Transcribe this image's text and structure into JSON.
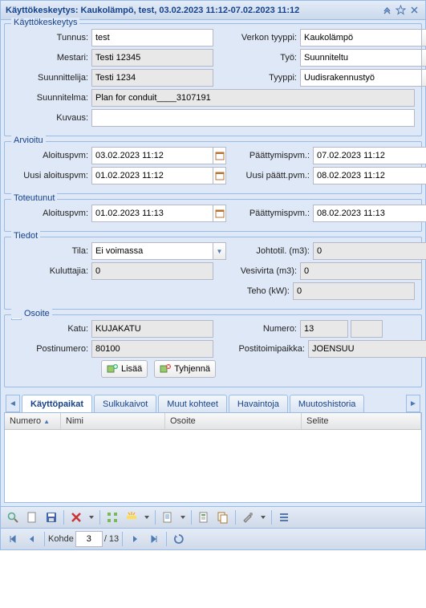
{
  "header": {
    "title": "Käyttökeskeytys: Kaukolämpö, test, 03.02.2023 11:12-07.02.2023 11:12"
  },
  "fs1": {
    "legend": "Käyttökeskeytys",
    "tunnus_label": "Tunnus:",
    "tunnus": "test",
    "verkko_label": "Verkon tyyppi:",
    "verkko": "Kaukolämpö",
    "mestari_label": "Mestari:",
    "mestari": "Testi 12345",
    "tyo_label": "Työ:",
    "tyo": "Suunniteltu",
    "suunnittelija_label": "Suunnittelija:",
    "suunnittelija": "Testi 1234",
    "tyyppi_label": "Tyyppi:",
    "tyyppi": "Uudisrakennustyö",
    "suunnitelma_label": "Suunnitelma:",
    "suunnitelma": "Plan for conduit____3107191",
    "kuvaus_label": "Kuvaus:",
    "kuvaus": ""
  },
  "fs2": {
    "legend": "Arvioitu",
    "aloitus_label": "Aloituspvm:",
    "aloitus": "03.02.2023 11:12",
    "paatty_label": "Päättymispvm.:",
    "paatty": "07.02.2023 11:12",
    "uusi_aloitus_label": "Uusi aloituspvm:",
    "uusi_aloitus": "01.02.2023 11:12",
    "uusi_paatty_label": "Uusi päätt.pvm.:",
    "uusi_paatty": "08.02.2023 11:12"
  },
  "fs3": {
    "legend": "Toteutunut",
    "aloitus_label": "Aloituspvm:",
    "aloitus": "01.02.2023 11:13",
    "paatty_label": "Päättymispvm.:",
    "paatty": "08.02.2023 11:13"
  },
  "fs4": {
    "legend": "Tiedot",
    "tila_label": "Tila:",
    "tila": "Ei voimassa",
    "johtotil_label": "Johtotil. (m3):",
    "johtotil": "0",
    "kuluttajia_label": "Kuluttajia:",
    "kuluttajia": "0",
    "vesivirta_label": "Vesivirta (m3):",
    "vesivirta": "0",
    "teho_label": "Teho (kW):",
    "teho": "0"
  },
  "fs5": {
    "legend": "Osoite",
    "katu_label": "Katu:",
    "katu": "KUJAKATU",
    "numero_label": "Numero:",
    "numero": "13",
    "postinumero_label": "Postinumero:",
    "postinumero": "80100",
    "toimipaikka_label": "Postitoimipaikka:",
    "toimipaikka": "JOENSUU",
    "lisaa": "Lisää",
    "tyhjenna": "Tyhjennä"
  },
  "tabs": {
    "t1": "Käyttöpaikat",
    "t2": "Sulkukaivot",
    "t3": "Muut kohteet",
    "t4": "Havaintoja",
    "t5": "Muutoshistoria"
  },
  "grid": {
    "c1": "Numero",
    "c2": "Nimi",
    "c3": "Osoite",
    "c4": "Selite"
  },
  "pager": {
    "label": "Kohde",
    "page": "3",
    "total": "/ 13"
  }
}
